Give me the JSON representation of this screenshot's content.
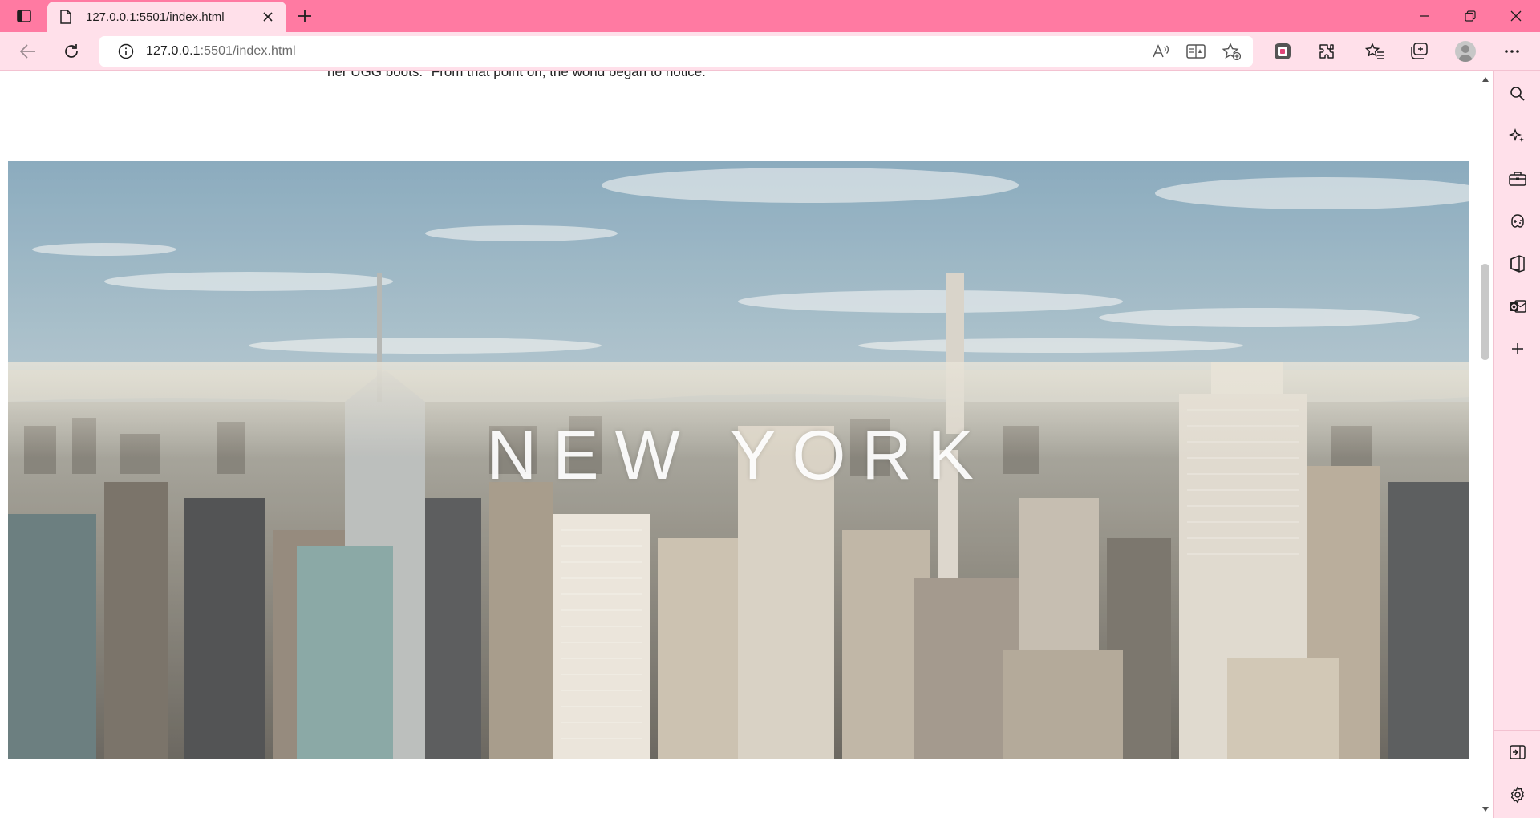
{
  "browser": {
    "tab_title": "127.0.0.1:5501/index.html",
    "url_host": "127.0.0.1",
    "url_rest": ":5501/index.html",
    "accent": "#ff7aa2",
    "toolbar_bg": "#ffe0ea"
  },
  "page": {
    "body_text": "her UGG boots.\" From that point on, the world began to notice.",
    "hero_title": "NEW YORK"
  },
  "icons": {
    "titlebar": [
      "sidebar-toggle-icon",
      "page-icon",
      "close-icon",
      "plus-icon",
      "minimize-icon",
      "restore-icon",
      "close-icon"
    ],
    "toolbar": [
      "back-icon",
      "refresh-icon",
      "info-icon",
      "read-aloud-icon",
      "immersive-reader-icon",
      "add-favorite-icon",
      "collections-extension-icon",
      "extensions-icon",
      "favorites-icon",
      "collections-icon",
      "profile-icon",
      "more-icon"
    ],
    "sidebar": [
      "search-icon",
      "copilot-icon",
      "tools-icon",
      "games-icon",
      "office-icon",
      "outlook-icon",
      "add-icon",
      "hide-sidebar-icon",
      "settings-icon"
    ]
  }
}
